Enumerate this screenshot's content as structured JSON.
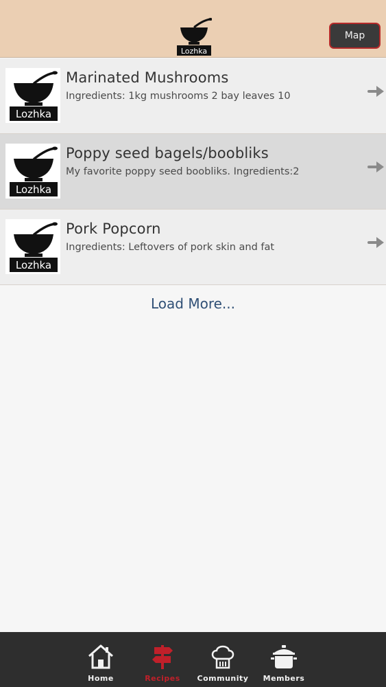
{
  "header": {
    "logo_text": "Lozhka",
    "map_label": "Map"
  },
  "recipes": [
    {
      "title": "Marinated Mushrooms",
      "description": "Ingredients: 1kg mushrooms 2 bay leaves 10",
      "thumb_text": "Lozhka",
      "icon": "arrow-right-icon"
    },
    {
      "title": "Poppy seed bagels/boobliks",
      "description": "My favorite poppy seed boobliks. Ingredients:2",
      "thumb_text": "Lozhka",
      "icon": "arrow-right-icon"
    },
    {
      "title": "Pork Popcorn",
      "description": "Ingredients: Leftovers of pork skin and fat",
      "thumb_text": "Lozhka",
      "icon": "arrow-right-icon"
    }
  ],
  "load_more": "Load More...",
  "tabbar": {
    "tabs": [
      {
        "label": "Home",
        "icon": "house-icon"
      },
      {
        "label": "Recipes",
        "icon": "signpost-icon",
        "active": true
      },
      {
        "label": "Community",
        "icon": "chef-hat-icon"
      },
      {
        "label": "Members",
        "icon": "cooking-pot-icon"
      }
    ]
  },
  "colors": {
    "header_bg": "#ebcfb3",
    "tabbar_bg": "#2e2e2e",
    "active_tab": "#c0202a",
    "link": "#2f4f75",
    "map_border": "#b52a2a"
  }
}
